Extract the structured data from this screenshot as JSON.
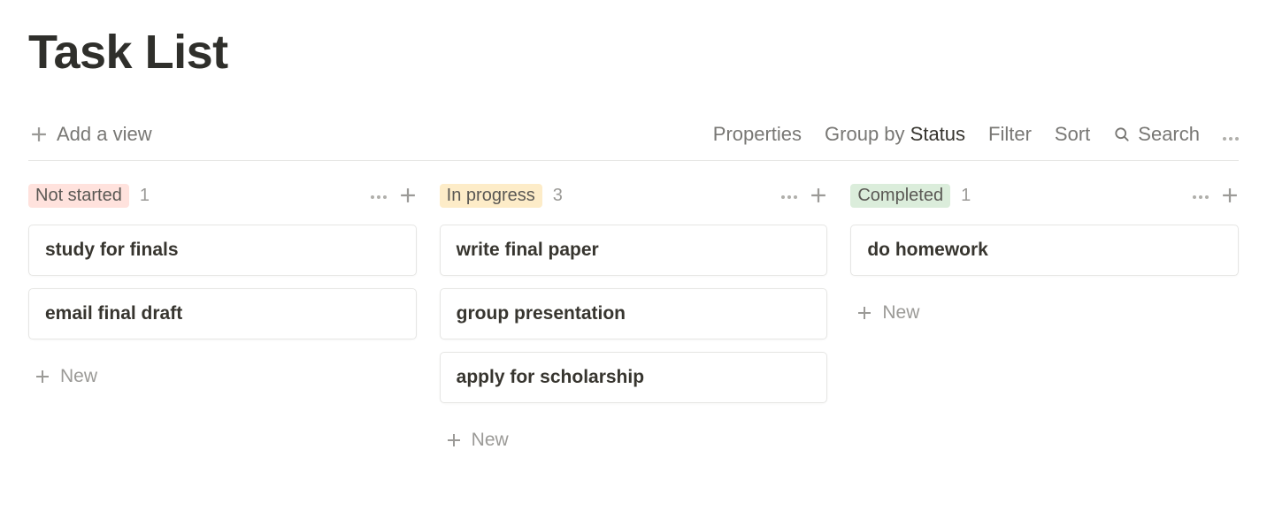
{
  "page": {
    "title": "Task List"
  },
  "toolbar": {
    "add_view": "Add a view",
    "properties": "Properties",
    "group_by_prefix": "Group by ",
    "group_by_value": "Status",
    "filter": "Filter",
    "sort": "Sort",
    "search": "Search"
  },
  "board": {
    "new_label": "New",
    "columns": [
      {
        "id": "not-started",
        "label": "Not started",
        "count": "1",
        "tag_class": "tag-notstarted",
        "cards": [
          {
            "title": "study for finals"
          },
          {
            "title": "email final draft"
          }
        ]
      },
      {
        "id": "in-progress",
        "label": "In progress",
        "count": "3",
        "tag_class": "tag-inprogress",
        "cards": [
          {
            "title": "write final paper"
          },
          {
            "title": "group presentation"
          },
          {
            "title": "apply for scholarship"
          }
        ]
      },
      {
        "id": "completed",
        "label": "Completed",
        "count": "1",
        "tag_class": "tag-completed",
        "cards": [
          {
            "title": "do homework"
          }
        ]
      }
    ]
  }
}
